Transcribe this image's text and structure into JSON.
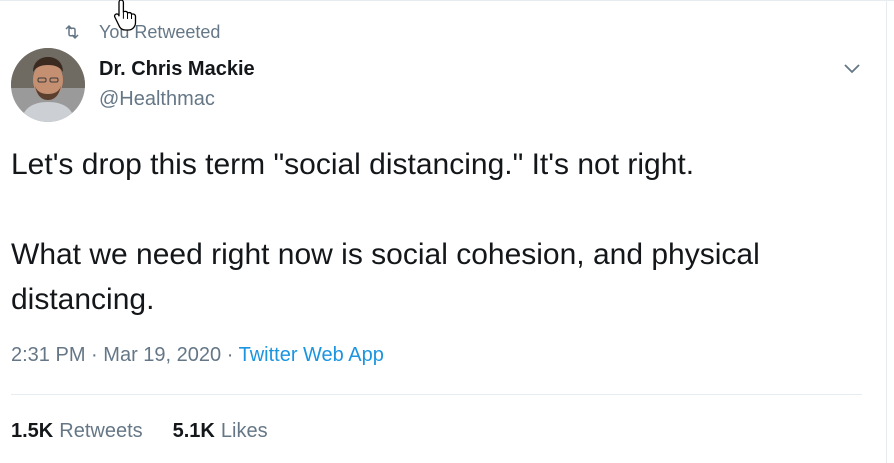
{
  "retweet_context": {
    "text": "You Retweeted",
    "icon": "retweet-icon"
  },
  "author": {
    "name": "Dr. Chris Mackie",
    "handle": "@Healthmac",
    "avatar": "avatar"
  },
  "tweet": {
    "paragraph1": "Let's drop this term \"social distancing.\" It's not right.",
    "paragraph2": "What we need right now is social cohesion, and physical distancing."
  },
  "meta": {
    "time": "2:31 PM",
    "sep1": "·",
    "date": "Mar 19, 2020",
    "sep2": "·",
    "source": "Twitter Web App"
  },
  "stats": {
    "retweets_count": "1.5K",
    "retweets_label": "Retweets",
    "likes_count": "5.1K",
    "likes_label": "Likes"
  },
  "colors": {
    "text": "#14171a",
    "secondary": "#657786",
    "link": "#1b95e0",
    "border": "#e6ecf0"
  }
}
